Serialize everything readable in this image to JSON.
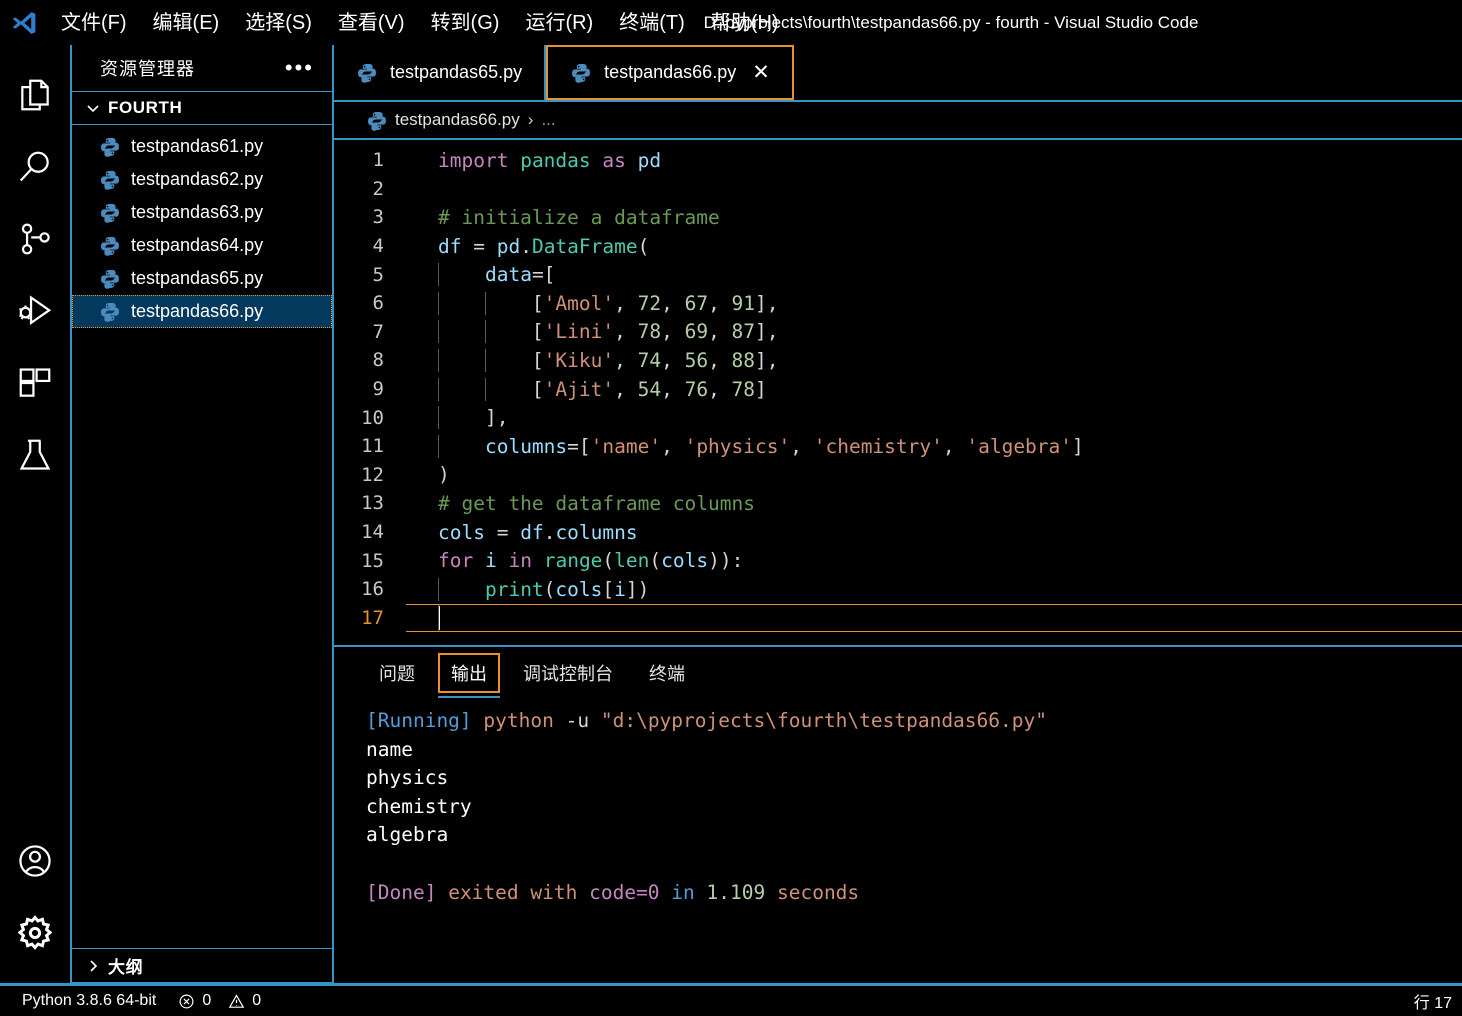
{
  "titlebar": {
    "logo_icon": "vscode-logo-icon",
    "window_title": "D:\\pyprojects\\fourth\\testpandas66.py - fourth - Visual Studio Code",
    "menus": [
      {
        "label": "文件(F)",
        "name": "menu-file"
      },
      {
        "label": "编辑(E)",
        "name": "menu-edit"
      },
      {
        "label": "选择(S)",
        "name": "menu-selection"
      },
      {
        "label": "查看(V)",
        "name": "menu-view"
      },
      {
        "label": "转到(G)",
        "name": "menu-go"
      },
      {
        "label": "运行(R)",
        "name": "menu-run"
      },
      {
        "label": "终端(T)",
        "name": "menu-terminal"
      },
      {
        "label": "帮助(H)",
        "name": "menu-help"
      }
    ]
  },
  "activitybar": {
    "items": [
      {
        "name": "explorer-icon"
      },
      {
        "name": "search-icon"
      },
      {
        "name": "source-control-icon"
      },
      {
        "name": "run-and-debug-icon"
      },
      {
        "name": "extensions-icon"
      },
      {
        "name": "testing-flask-icon"
      }
    ],
    "bottom_items": [
      {
        "name": "account-icon"
      },
      {
        "name": "gear-icon"
      }
    ]
  },
  "sidebar": {
    "title": "资源管理器",
    "more_label": "•••",
    "section": {
      "label": "FOURTH",
      "expanded": true
    },
    "files": [
      {
        "label": "testpandas61.py",
        "selected": false
      },
      {
        "label": "testpandas62.py",
        "selected": false
      },
      {
        "label": "testpandas63.py",
        "selected": false
      },
      {
        "label": "testpandas64.py",
        "selected": false
      },
      {
        "label": "testpandas65.py",
        "selected": false
      },
      {
        "label": "testpandas66.py",
        "selected": true
      }
    ],
    "outline_label": "大纲"
  },
  "tabs": [
    {
      "label": "testpandas65.py",
      "active": false
    },
    {
      "label": "testpandas66.py",
      "active": true,
      "close_label": "✕"
    }
  ],
  "breadcrumb": {
    "file": "testpandas66.py",
    "separator": "›",
    "dots": "..."
  },
  "editor": {
    "active_line": 17,
    "lines": [
      {
        "n": "1",
        "tokens": [
          {
            "t": "import",
            "c": "kw"
          },
          {
            "t": " ",
            "c": "op"
          },
          {
            "t": "pandas",
            "c": "mod"
          },
          {
            "t": " ",
            "c": "op"
          },
          {
            "t": "as",
            "c": "kw"
          },
          {
            "t": " ",
            "c": "op"
          },
          {
            "t": "pd",
            "c": "var"
          }
        ]
      },
      {
        "n": "2",
        "tokens": []
      },
      {
        "n": "3",
        "tokens": [
          {
            "t": "# initialize a dataframe",
            "c": "com"
          }
        ]
      },
      {
        "n": "4",
        "tokens": [
          {
            "t": "df",
            "c": "var"
          },
          {
            "t": " = ",
            "c": "op"
          },
          {
            "t": "pd",
            "c": "var"
          },
          {
            "t": ".",
            "c": "op"
          },
          {
            "t": "DataFrame",
            "c": "mod"
          },
          {
            "t": "(",
            "c": "op"
          }
        ]
      },
      {
        "n": "5",
        "tokens": [
          {
            "t": "    ",
            "c": "op"
          },
          {
            "t": "data",
            "c": "var"
          },
          {
            "t": "=[",
            "c": "op"
          }
        ]
      },
      {
        "n": "6",
        "tokens": [
          {
            "t": "        [",
            "c": "op"
          },
          {
            "t": "'Amol'",
            "c": "str"
          },
          {
            "t": ", ",
            "c": "op"
          },
          {
            "t": "72",
            "c": "num"
          },
          {
            "t": ", ",
            "c": "op"
          },
          {
            "t": "67",
            "c": "num"
          },
          {
            "t": ", ",
            "c": "op"
          },
          {
            "t": "91",
            "c": "num"
          },
          {
            "t": "],",
            "c": "op"
          }
        ]
      },
      {
        "n": "7",
        "tokens": [
          {
            "t": "        [",
            "c": "op"
          },
          {
            "t": "'Lini'",
            "c": "str"
          },
          {
            "t": ", ",
            "c": "op"
          },
          {
            "t": "78",
            "c": "num"
          },
          {
            "t": ", ",
            "c": "op"
          },
          {
            "t": "69",
            "c": "num"
          },
          {
            "t": ", ",
            "c": "op"
          },
          {
            "t": "87",
            "c": "num"
          },
          {
            "t": "],",
            "c": "op"
          }
        ]
      },
      {
        "n": "8",
        "tokens": [
          {
            "t": "        [",
            "c": "op"
          },
          {
            "t": "'Kiku'",
            "c": "str"
          },
          {
            "t": ", ",
            "c": "op"
          },
          {
            "t": "74",
            "c": "num"
          },
          {
            "t": ", ",
            "c": "op"
          },
          {
            "t": "56",
            "c": "num"
          },
          {
            "t": ", ",
            "c": "op"
          },
          {
            "t": "88",
            "c": "num"
          },
          {
            "t": "],",
            "c": "op"
          }
        ]
      },
      {
        "n": "9",
        "tokens": [
          {
            "t": "        [",
            "c": "op"
          },
          {
            "t": "'Ajit'",
            "c": "str"
          },
          {
            "t": ", ",
            "c": "op"
          },
          {
            "t": "54",
            "c": "num"
          },
          {
            "t": ", ",
            "c": "op"
          },
          {
            "t": "76",
            "c": "num"
          },
          {
            "t": ", ",
            "c": "op"
          },
          {
            "t": "78",
            "c": "num"
          },
          {
            "t": "]",
            "c": "op"
          }
        ]
      },
      {
        "n": "10",
        "tokens": [
          {
            "t": "    ],",
            "c": "op"
          }
        ]
      },
      {
        "n": "11",
        "tokens": [
          {
            "t": "    ",
            "c": "op"
          },
          {
            "t": "columns",
            "c": "var"
          },
          {
            "t": "=[",
            "c": "op"
          },
          {
            "t": "'name'",
            "c": "str"
          },
          {
            "t": ", ",
            "c": "op"
          },
          {
            "t": "'physics'",
            "c": "str"
          },
          {
            "t": ", ",
            "c": "op"
          },
          {
            "t": "'chemistry'",
            "c": "str"
          },
          {
            "t": ", ",
            "c": "op"
          },
          {
            "t": "'algebra'",
            "c": "str"
          },
          {
            "t": "]",
            "c": "op"
          }
        ]
      },
      {
        "n": "12",
        "tokens": [
          {
            "t": ")",
            "c": "op"
          }
        ]
      },
      {
        "n": "13",
        "tokens": [
          {
            "t": "# get the dataframe columns",
            "c": "com"
          }
        ]
      },
      {
        "n": "14",
        "tokens": [
          {
            "t": "cols",
            "c": "var"
          },
          {
            "t": " = ",
            "c": "op"
          },
          {
            "t": "df",
            "c": "var"
          },
          {
            "t": ".",
            "c": "op"
          },
          {
            "t": "columns",
            "c": "var"
          }
        ]
      },
      {
        "n": "15",
        "tokens": [
          {
            "t": "for",
            "c": "kw"
          },
          {
            "t": " ",
            "c": "op"
          },
          {
            "t": "i",
            "c": "var"
          },
          {
            "t": " ",
            "c": "op"
          },
          {
            "t": "in",
            "c": "kw"
          },
          {
            "t": " ",
            "c": "op"
          },
          {
            "t": "range",
            "c": "mod"
          },
          {
            "t": "(",
            "c": "op"
          },
          {
            "t": "len",
            "c": "mod"
          },
          {
            "t": "(",
            "c": "op"
          },
          {
            "t": "cols",
            "c": "var"
          },
          {
            "t": ")):",
            "c": "op"
          }
        ]
      },
      {
        "n": "16",
        "tokens": [
          {
            "t": "    ",
            "c": "op"
          },
          {
            "t": "print",
            "c": "mod"
          },
          {
            "t": "(",
            "c": "op"
          },
          {
            "t": "cols",
            "c": "var"
          },
          {
            "t": "[",
            "c": "op"
          },
          {
            "t": "i",
            "c": "var"
          },
          {
            "t": "])",
            "c": "op"
          }
        ]
      },
      {
        "n": "17",
        "tokens": [],
        "current": true
      }
    ]
  },
  "panel": {
    "tabs": [
      {
        "label": "问题",
        "active": false
      },
      {
        "label": "输出",
        "active": true
      },
      {
        "label": "调试控制台",
        "active": false
      },
      {
        "label": "终端",
        "active": false
      }
    ],
    "output_lines": [
      {
        "segs": [
          {
            "t": "[Running]",
            "c": "tag-run"
          },
          {
            "t": " ",
            "c": "plain"
          },
          {
            "t": "python",
            "c": "cmd"
          },
          {
            "t": " ",
            "c": "plain"
          },
          {
            "t": "-u",
            "c": "flag"
          },
          {
            "t": " ",
            "c": "plain"
          },
          {
            "t": "\"d:\\pyprojects\\fourth\\testpandas66.py\"",
            "c": "path"
          }
        ]
      },
      {
        "segs": [
          {
            "t": "name",
            "c": "plain"
          }
        ]
      },
      {
        "segs": [
          {
            "t": "physics",
            "c": "plain"
          }
        ]
      },
      {
        "segs": [
          {
            "t": "chemistry",
            "c": "plain"
          }
        ]
      },
      {
        "segs": [
          {
            "t": "algebra",
            "c": "plain"
          }
        ]
      },
      {
        "segs": []
      },
      {
        "segs": [
          {
            "t": "[Done]",
            "c": "tag-done"
          },
          {
            "t": " ",
            "c": "plain"
          },
          {
            "t": "exited with",
            "c": "word"
          },
          {
            "t": " ",
            "c": "plain"
          },
          {
            "t": "code=0",
            "c": "kw"
          },
          {
            "t": " ",
            "c": "plain"
          },
          {
            "t": "in",
            "c": "in"
          },
          {
            "t": " ",
            "c": "plain"
          },
          {
            "t": "1.109",
            "c": "num"
          },
          {
            "t": " ",
            "c": "plain"
          },
          {
            "t": "seconds",
            "c": "word"
          }
        ]
      }
    ]
  },
  "statusbar": {
    "python_version": "Python 3.8.6 64-bit",
    "errors": "0",
    "warnings": "0",
    "cursor_position": "行 17"
  },
  "colors": {
    "accent_border": "#3794c7",
    "focus_orange": "#e8912d",
    "selection_blue": "#04395e",
    "background": "#000000"
  }
}
